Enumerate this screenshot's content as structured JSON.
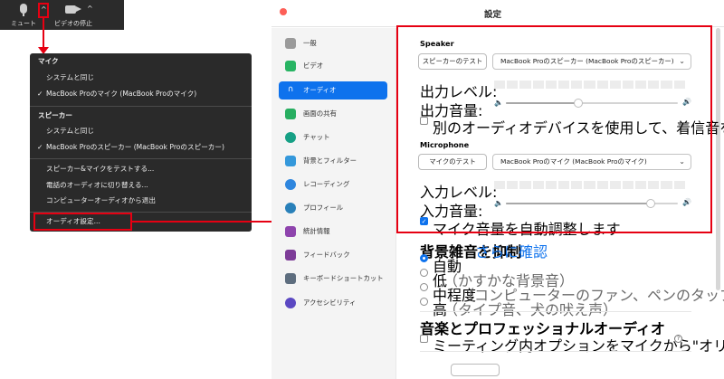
{
  "toolbar": {
    "mute_label": "ミュート",
    "video_label": "ビデオの停止",
    "caret": "^"
  },
  "audio_menu": {
    "mic_heading": "マイク",
    "mic_same_as_system": "システムと同じ",
    "mic_selected": "MacBook Proのマイク (MacBook Proのマイク)",
    "speaker_heading": "スピーカー",
    "speaker_same_as_system": "システムと同じ",
    "speaker_selected": "MacBook Proのスピーカー (MacBook Proのスピーカー)",
    "test_speaker_mic": "スピーカー&マイクをテストする...",
    "switch_to_phone": "電話のオーディオに切り替える...",
    "leave_computer_audio": "コンピューターオーディオから退出",
    "audio_settings": "オーディオ設定...",
    "check_mark": "✓"
  },
  "window": {
    "title": "設定"
  },
  "sidebar": {
    "items": [
      {
        "label": "一般",
        "color": "#9a9a9a"
      },
      {
        "label": "ビデオ",
        "color": "#28b463"
      },
      {
        "label": "オーディオ",
        "color": "#0e72ed",
        "active": true
      },
      {
        "label": "画面の共有",
        "color": "#27ae60"
      },
      {
        "label": "チャット",
        "color": "#16a085"
      },
      {
        "label": "背景とフィルター",
        "color": "#3498db"
      },
      {
        "label": "レコーディング",
        "color": "#2e86de"
      },
      {
        "label": "プロフィール",
        "color": "#2980b9"
      },
      {
        "label": "統計情報",
        "color": "#8e44ad"
      },
      {
        "label": "フィードバック",
        "color": "#7d3c98"
      },
      {
        "label": "キーボードショートカット",
        "color": "#5d6d7e"
      },
      {
        "label": "アクセシビリティ",
        "color": "#5b48c2"
      }
    ]
  },
  "speaker": {
    "title": "Speaker",
    "test_button": "スピーカーのテスト",
    "device": "MacBook Proのスピーカー (MacBook Proのスピーカー)",
    "output_level_label": "出力レベル:",
    "output_volume_label": "出力音量:",
    "output_volume": 0.42,
    "separate_device_label": "別のオーディオデバイスを使用して、着信音を鳴らします"
  },
  "microphone": {
    "title": "Microphone",
    "test_button": "マイクのテスト",
    "device": "MacBook Proのマイク (MacBook Proのマイク)",
    "input_level_label": "入力レベル:",
    "input_volume_label": "入力音量:",
    "input_volume": 0.84,
    "auto_adjust_label": "マイク音量を自動調整します"
  },
  "noise": {
    "title": "背景雑音を抑制",
    "learn_more": "さらに確認",
    "options": [
      {
        "label": "自動",
        "hint": "",
        "selected": true
      },
      {
        "label": "低",
        "hint": "（かすかな背景音）"
      },
      {
        "label": "中程度",
        "hint": "（コンピューターのファン、ペンのタップ音）"
      },
      {
        "label": "高",
        "hint": "（タイプ音、犬の吠え声）"
      }
    ]
  },
  "pro_audio": {
    "title": "音楽とプロフェッショナルオーディオ",
    "original_sound_label": "ミーティング内オプションをマイクから\"オリジナルサウンドを有効化\"に表示",
    "help": "?"
  },
  "icons": {
    "speaker_low": "🔈",
    "speaker_high": "🔊",
    "chevron": "⌄",
    "checkmark": "✓"
  },
  "colors": {
    "accent": "#0e72ed",
    "highlight_red": "#e60012",
    "toolbar_bg": "#2b2b2b",
    "menu_bg": "#2a2a2a"
  }
}
